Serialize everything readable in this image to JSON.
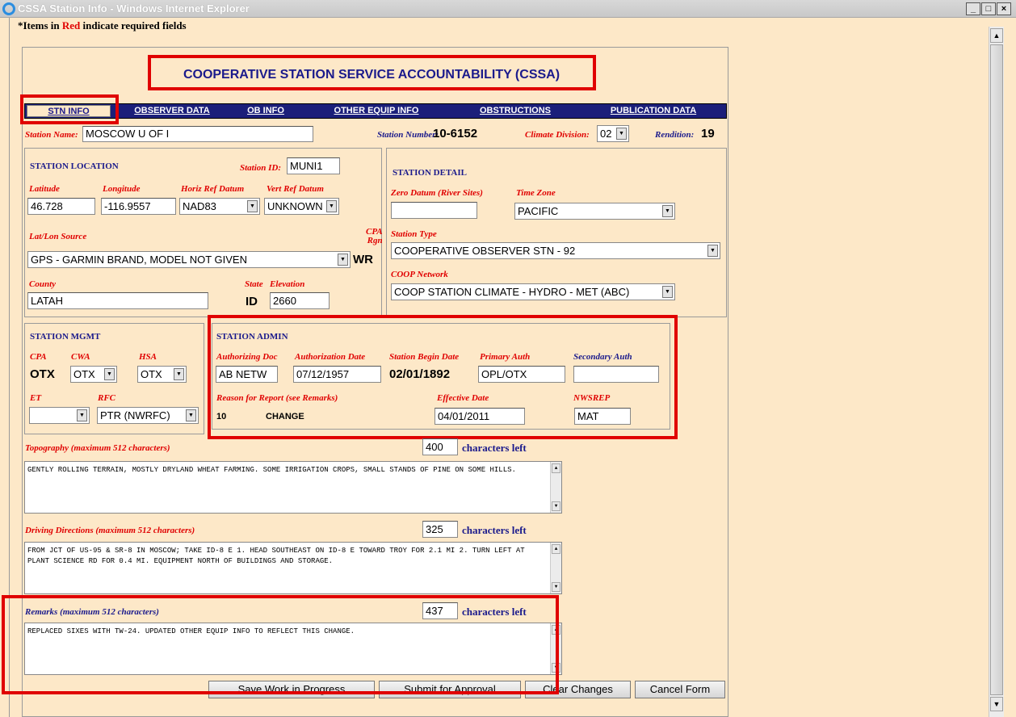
{
  "window": {
    "title": "CSSA Station Info - Windows Internet Explorer"
  },
  "notice": {
    "prefix": "*Items in ",
    "red": "Red",
    "suffix": " indicate required fields"
  },
  "form_title": "COOPERATIVE STATION SERVICE ACCOUNTABILITY (CSSA)",
  "tabs": [
    {
      "label": "STN INFO",
      "active": true
    },
    {
      "label": "OBSERVER DATA"
    },
    {
      "label": "OB INFO"
    },
    {
      "label": "OTHER EQUIP INFO"
    },
    {
      "label": "OBSTRUCTIONS"
    },
    {
      "label": "PUBLICATION DATA"
    }
  ],
  "header": {
    "station_name_label": "Station Name:",
    "station_name": "MOSCOW U OF I",
    "station_number_label": "Station Number:",
    "station_number": "10-6152",
    "climate_division_label": "Climate Division:",
    "climate_division": "02",
    "rendition_label": "Rendition:",
    "rendition": "19"
  },
  "location": {
    "section": "STATION LOCATION",
    "station_id_label": "Station ID:",
    "station_id": "MUNI1",
    "latitude_label": "Latitude",
    "latitude": "46.728",
    "longitude_label": "Longitude",
    "longitude": "-116.9557",
    "horiz_label": "Horiz Ref Datum",
    "horiz": "NAD83",
    "vert_label": "Vert Ref Datum",
    "vert": "UNKNOWN",
    "latlon_source_label": "Lat/Lon Source",
    "latlon_source": "GPS - GARMIN BRAND, MODEL NOT GIVEN",
    "cpa_rgn_label1": "CPA",
    "cpa_rgn_label2": "Rgn",
    "cpa_rgn": "WR",
    "county_label": "County",
    "county": "LATAH",
    "state_label": "State",
    "state": "ID",
    "elevation_label": "Elevation",
    "elevation": "2660"
  },
  "detail": {
    "section": "STATION DETAIL",
    "zero_datum_label": "Zero Datum (River Sites)",
    "zero_datum": "",
    "time_zone_label": "Time Zone",
    "time_zone": "PACIFIC",
    "station_type_label": "Station Type",
    "station_type": "COOPERATIVE OBSERVER STN - 92",
    "coop_network_label": "COOP Network",
    "coop_network": "COOP STATION CLIMATE - HYDRO - MET (ABC)"
  },
  "mgmt": {
    "section": "STATION MGMT",
    "cpa_label": "CPA",
    "cpa": "OTX",
    "cwa_label": "CWA",
    "cwa": "OTX",
    "hsa_label": "HSA",
    "hsa": "OTX",
    "et_label": "ET",
    "et": "",
    "rfc_label": "RFC",
    "rfc": "PTR (NWRFC)"
  },
  "admin": {
    "section": "STATION ADMIN",
    "auth_doc_label": "Authorizing Doc",
    "auth_doc": "AB NETW",
    "auth_date_label": "Authorization Date",
    "auth_date": "07/12/1957",
    "begin_date_label": "Station Begin Date",
    "begin_date": "02/01/1892",
    "primary_auth_label": "Primary Auth",
    "primary_auth": "OPL/OTX",
    "secondary_auth_label": "Secondary Auth",
    "secondary_auth": "",
    "reason_label": "Reason for Report (see Remarks)",
    "reason_code": "10",
    "reason_text": "CHANGE",
    "effective_date_label": "Effective Date",
    "effective_date": "04/01/2011",
    "nwsrep_label": "NWSREP",
    "nwsrep": "MAT"
  },
  "topography": {
    "label": "Topography (maximum 512 characters)",
    "count": "400",
    "count_label": "characters left",
    "text": "GENTLY ROLLING TERRAIN, MOSTLY DRYLAND WHEAT FARMING. SOME IRRIGATION CROPS, SMALL STANDS OF PINE ON SOME HILLS."
  },
  "directions": {
    "label": "Driving Directions (maximum 512 characters)",
    "count": "325",
    "count_label": "characters left",
    "text": "FROM JCT OF US-95 & SR-8 IN MOSCOW; TAKE ID-8 E  1. HEAD SOUTHEAST ON ID-8 E TOWARD TROY FOR 2.1 MI  2. TURN LEFT AT PLANT SCIENCE RD FOR 0.4 MI. EQUIPMENT NORTH OF BUILDINGS AND STORAGE."
  },
  "remarks": {
    "label": "Remarks (maximum 512 characters)",
    "count": "437",
    "count_label": "characters left",
    "text": "REPLACED SIXES WITH TW-24. UPDATED OTHER EQUIP INFO TO REFLECT THIS CHANGE."
  },
  "buttons": {
    "save": "Save Work in Progress",
    "submit": "Submit for Approval",
    "clear": "Clear Changes",
    "cancel": "Cancel Form"
  }
}
